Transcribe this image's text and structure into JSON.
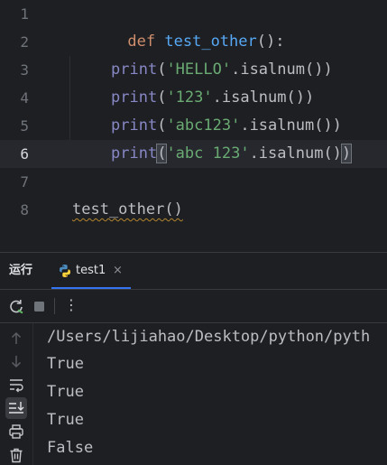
{
  "editor": {
    "line_numbers": [
      "1",
      "2",
      "3",
      "4",
      "5",
      "6",
      "7",
      "8"
    ],
    "current_line": "6",
    "line1": {
      "kw": "def",
      "name": "test_other",
      "tail": "():"
    },
    "line3": {
      "fn": "print",
      "open": "(",
      "str": "'HELLO'",
      "rest": ".isalnum())"
    },
    "line4": {
      "fn": "print",
      "open": "(",
      "str": "'123'",
      "rest": ".isalnum())"
    },
    "line5": {
      "fn": "print",
      "open": "(",
      "str": "'abc123'",
      "rest": ".isalnum())"
    },
    "line6": {
      "fn": "print",
      "open": "(",
      "str": "'abc 123'",
      "rest": ".isalnum()",
      "close": ")"
    },
    "line8": {
      "call": "test_other()"
    }
  },
  "run_panel": {
    "title": "运行",
    "tab_label": "test1",
    "tab_close": "×",
    "tab_icon": "python-icon",
    "toolbar_icons": [
      "rerun-icon",
      "stop-icon",
      "more-icon"
    ],
    "more_glyph": "⋮",
    "sidebar_icons": [
      "up-arrow-icon",
      "down-arrow-icon",
      "soft-wrap-icon",
      "scroll-to-end-icon",
      "print-icon",
      "trash-icon"
    ],
    "accent": "#3574f0"
  },
  "console": {
    "lines": [
      "/Users/lijiahao/Desktop/python/pyth",
      "True",
      "True",
      "True",
      "False"
    ]
  }
}
